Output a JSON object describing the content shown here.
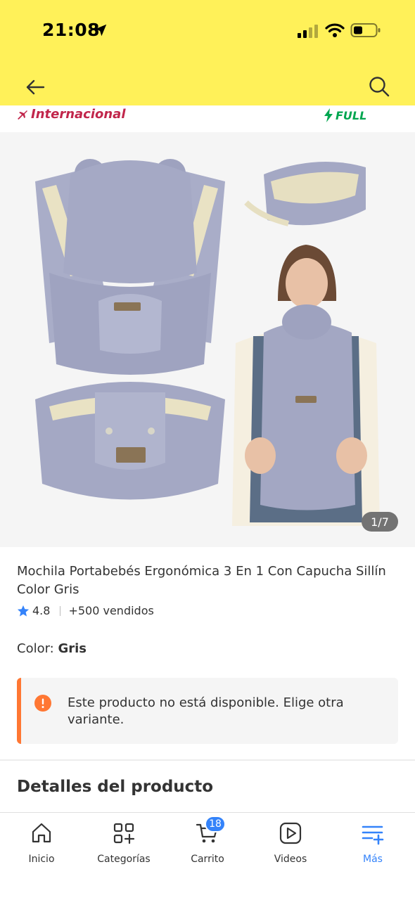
{
  "status_bar": {
    "time": "21:08"
  },
  "header": {
    "back_icon": "arrow-left-icon",
    "search_icon": "search-icon",
    "background_color": "#fff159"
  },
  "badges": {
    "international_label": "Internacional",
    "full_label": "FULL"
  },
  "gallery": {
    "counter": "1/7"
  },
  "product": {
    "title": "Mochila Portabebés Ergonómica 3 En 1 Con Capucha Sillín Color Gris",
    "rating": "4.8",
    "sold": "+500 vendidos",
    "color_label": "Color:",
    "color_value": "Gris"
  },
  "alert": {
    "message": "Este producto no está disponible. Elige otra variante.",
    "accent_color": "#ff7733"
  },
  "section": {
    "details_title": "Detalles del producto"
  },
  "tabbar": {
    "active_color": "#3483fa",
    "cart_count": "18",
    "tabs": [
      {
        "label": "Inicio",
        "icon": "home-icon"
      },
      {
        "label": "Categorías",
        "icon": "categories-icon"
      },
      {
        "label": "Carrito",
        "icon": "cart-icon"
      },
      {
        "label": "Videos",
        "icon": "video-icon"
      },
      {
        "label": "Más",
        "icon": "menu-plus-icon"
      }
    ]
  }
}
